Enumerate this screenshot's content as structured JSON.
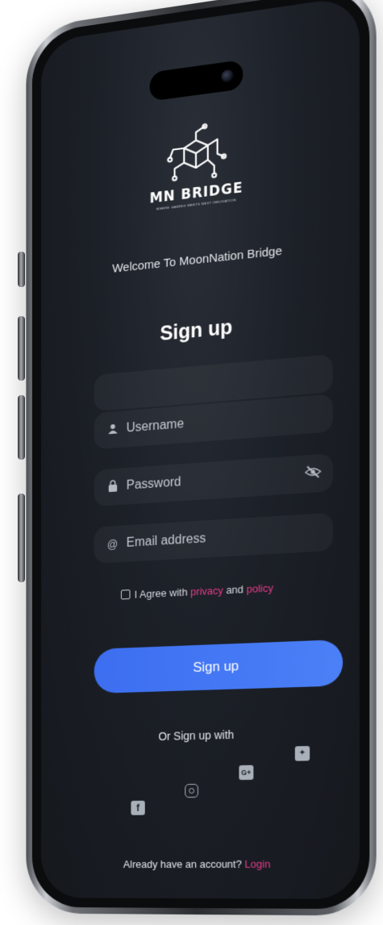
{
  "brand": {
    "name": "MN BRIDGE",
    "tagline": "WHERE GAMING MEETS NEXT INNOVATION"
  },
  "welcome": "Welcome To MoonNation Bridge",
  "title": "Sign up",
  "form": {
    "username_placeholder": "Username",
    "password_placeholder": "Password",
    "email_placeholder": "Email address",
    "agree_prefix": "I Agree with",
    "agree_privacy": "privacy",
    "agree_and": "and",
    "agree_policy": "policy",
    "submit_label": "Sign up"
  },
  "social": {
    "heading": "Or Sign up with",
    "providers": [
      "facebook",
      "instagram",
      "google-plus",
      "twitter"
    ]
  },
  "footer": {
    "question": "Already have an account?",
    "login_label": "Login"
  },
  "colors": {
    "accent_blue": "#3c6ef0",
    "accent_pink": "#e63b8a",
    "screen_bg": "#1c2027"
  },
  "icons": {
    "username": "user-icon",
    "password": "lock-icon",
    "password_toggle": "eye-slash-icon",
    "email": "at-icon"
  }
}
